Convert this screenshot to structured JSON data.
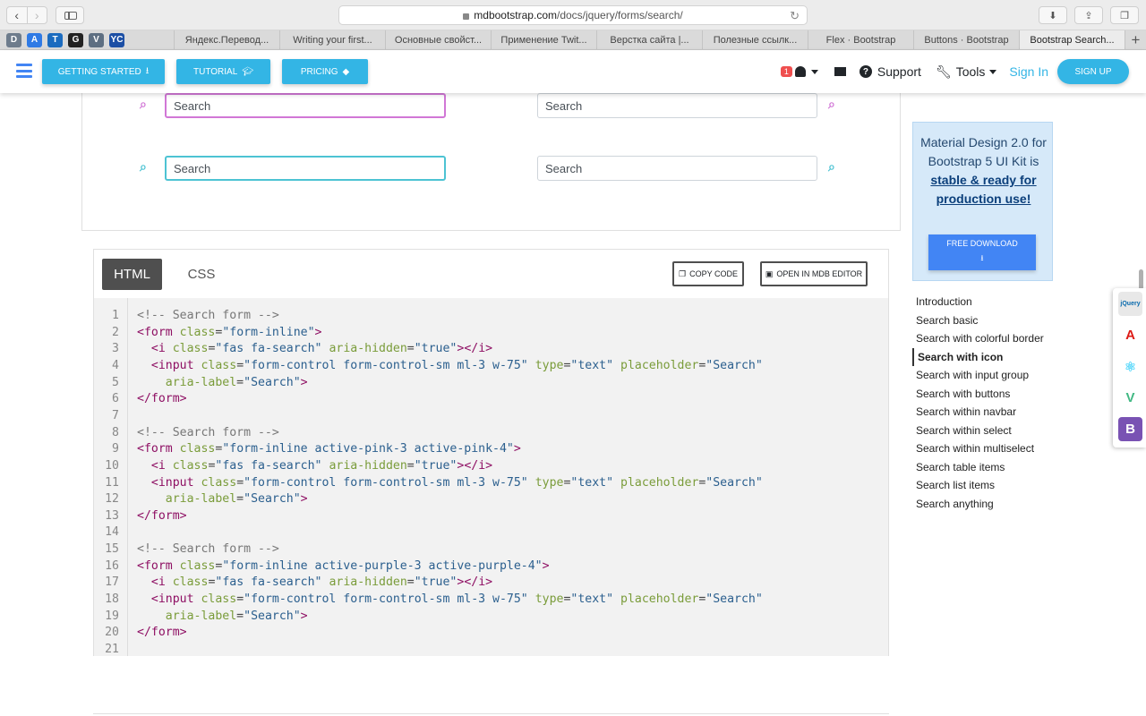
{
  "browser": {
    "url_host": "mdbootstrap.com",
    "url_path": "/docs/jquery/forms/search/",
    "back_icon": "chevron-left-icon",
    "forward_icon": "chevron-right-icon",
    "bookmarks": [
      {
        "icon": "D",
        "color": "#6e7c8c"
      },
      {
        "icon": "A",
        "color": "#2f7ae5"
      },
      {
        "icon": "T",
        "color": "#1b6bbf"
      },
      {
        "icon": "G",
        "color": "#222222"
      },
      {
        "icon": "V",
        "color": "#5e6f82"
      },
      {
        "icon": "YC",
        "color": "#1c4fa5"
      }
    ],
    "tabs": [
      "Яндекс.Перевод...",
      "Writing your first...",
      "Основные свойст...",
      "Применение Twit...",
      "Верстка сайта |...",
      "Полезные ссылк...",
      "Flex · Bootstrap",
      "Buttons · Bootstrap",
      "Bootstrap Search..."
    ],
    "new_tab": "+"
  },
  "nav": {
    "getting_started": "GETTING STARTED",
    "tutorial": "TUTORIAL",
    "pricing": "PRICING",
    "notif_count": "1",
    "support": "Support",
    "tools": "Tools",
    "sign_in": "Sign In",
    "sign_up": "SIGN UP"
  },
  "demo": {
    "placeholder": "Search",
    "rows": [
      {
        "color": "#d177d6"
      },
      {
        "color": "#4dc3d3"
      }
    ]
  },
  "code_card": {
    "tab_html": "HTML",
    "tab_css": "CSS",
    "copy_code": "COPY CODE",
    "open_editor": "OPEN IN MDB EDITOR"
  },
  "code_lines": [
    [
      "1",
      "<!-- Search form -->"
    ],
    [
      "2",
      "<form class=\"form-inline\">"
    ],
    [
      "3",
      "  <i class=\"fas fa-search\" aria-hidden=\"true\"></i>"
    ],
    [
      "4",
      "  <input class=\"form-control form-control-sm ml-3 w-75\" type=\"text\" placeholder=\"Search\""
    ],
    [
      "5",
      "    aria-label=\"Search\">"
    ],
    [
      "6",
      "</form>"
    ],
    [
      "7",
      ""
    ],
    [
      "8",
      "<!-- Search form -->"
    ],
    [
      "9",
      "<form class=\"form-inline active-pink-3 active-pink-4\">"
    ],
    [
      "10",
      "  <i class=\"fas fa-search\" aria-hidden=\"true\"></i>"
    ],
    [
      "11",
      "  <input class=\"form-control form-control-sm ml-3 w-75\" type=\"text\" placeholder=\"Search\""
    ],
    [
      "12",
      "    aria-label=\"Search\">"
    ],
    [
      "13",
      "</form>"
    ],
    [
      "14",
      ""
    ],
    [
      "15",
      "<!-- Search form -->"
    ],
    [
      "16",
      "<form class=\"form-inline active-purple-3 active-purple-4\">"
    ],
    [
      "17",
      "  <i class=\"fas fa-search\" aria-hidden=\"true\"></i>"
    ],
    [
      "18",
      "  <input class=\"form-control form-control-sm ml-3 w-75\" type=\"text\" placeholder=\"Search\""
    ],
    [
      "19",
      "    aria-label=\"Search\">"
    ],
    [
      "20",
      "</form>"
    ],
    [
      "21",
      ""
    ]
  ],
  "promo": {
    "line1": "Material Design 2.0 for Bootstrap 5 UI Kit is",
    "link": "stable & ready for production use!",
    "button": "FREE DOWNLOAD"
  },
  "toc": [
    "Introduction",
    "Search basic",
    "Search with colorful border",
    "Search with icon",
    "Search with input group",
    "Search with buttons",
    "Search within navbar",
    "Search within select",
    "Search within multiselect",
    "Search table items",
    "Search list items",
    "Search anything"
  ],
  "toc_active": "Search with icon",
  "frameworks": [
    {
      "name": "jquery-icon",
      "label": "jQuery",
      "color": "#0769ad"
    },
    {
      "name": "angular-icon",
      "label": "A",
      "color": "#dd1b16"
    },
    {
      "name": "react-icon",
      "label": "⚛",
      "color": "#61dafb"
    },
    {
      "name": "vue-icon",
      "label": "V",
      "color": "#41b883"
    },
    {
      "name": "bootstrap-icon",
      "label": "B",
      "color": "#7952b3"
    }
  ]
}
